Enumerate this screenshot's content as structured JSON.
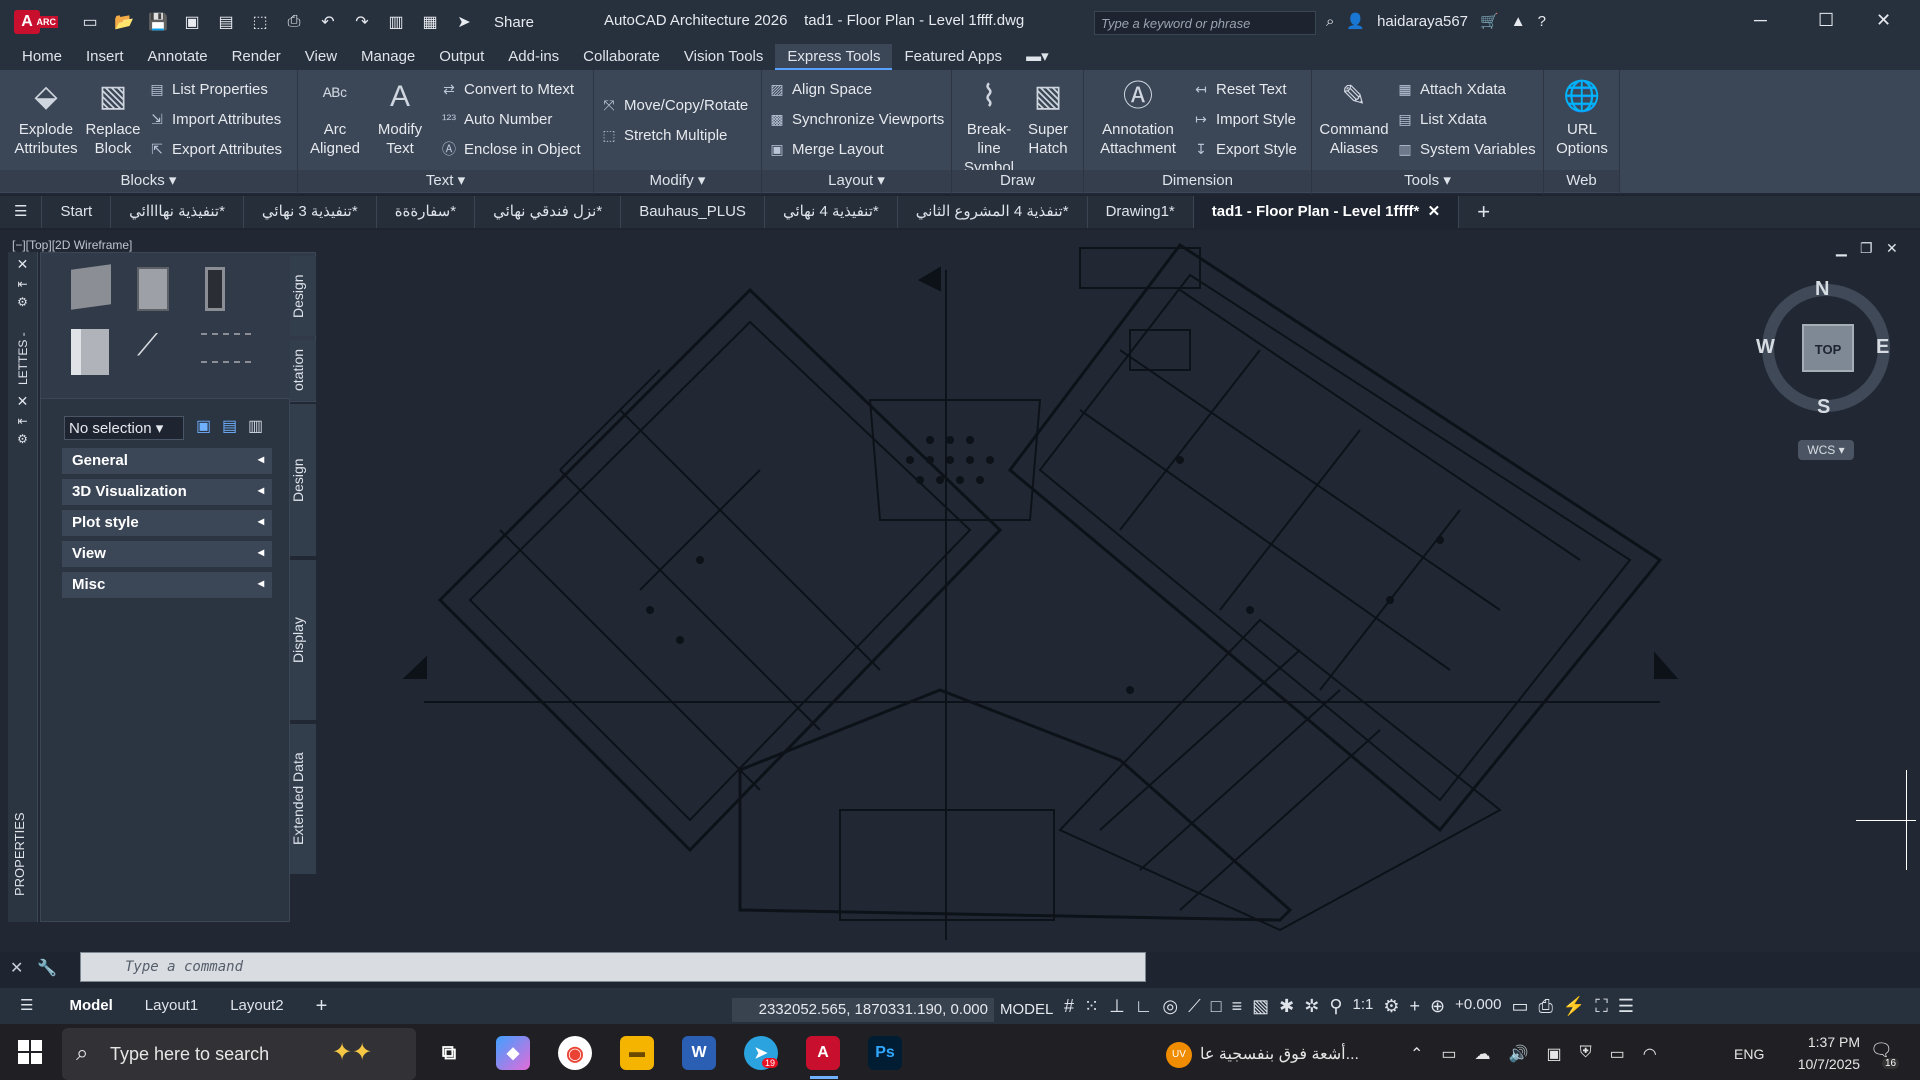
{
  "titlebar": {
    "app_badge": "A",
    "app_badge_sub": "ARC",
    "share_label": "Share",
    "app_name": "AutoCAD Architecture 2026",
    "document": "tad1 - Floor Plan - Level 1ffff.dwg",
    "search_placeholder": "Type a keyword or phrase",
    "username": "haidaraya567"
  },
  "ribbon_tabs": [
    "Home",
    "Insert",
    "Annotate",
    "Render",
    "View",
    "Manage",
    "Output",
    "Add-ins",
    "Collaborate",
    "Vision Tools",
    "Express Tools",
    "Featured Apps"
  ],
  "active_ribbon_tab": "Express Tools",
  "ribbon": {
    "blocks": {
      "label": "Blocks",
      "explode": "Explode Attributes",
      "replace": "Replace Block",
      "list_props": "List Properties",
      "import_attr": "Import Attributes",
      "export_attr": "Export Attributes"
    },
    "text": {
      "label": "Text",
      "arc_aligned": "Arc Aligned",
      "modify_text": "Modify Text",
      "convert_mtext": "Convert to Mtext",
      "auto_number": "Auto Number",
      "enclose": "Enclose in Object"
    },
    "modify": {
      "label": "Modify",
      "move_copy": "Move/Copy/Rotate",
      "stretch": "Stretch Multiple"
    },
    "layout": {
      "label": "Layout",
      "align_space": "Align Space",
      "sync_viewports": "Synchronize Viewports",
      "merge_layout": "Merge Layout"
    },
    "draw": {
      "label": "Draw",
      "breakline": "Break-line Symbol",
      "super_hatch": "Super Hatch"
    },
    "dimension": {
      "label": "Dimension",
      "annotation_attach": "Annotation Attachment",
      "reset_text": "Reset Text",
      "import_style": "Import Style",
      "export_style": "Export Style"
    },
    "tools": {
      "label": "Tools",
      "command_aliases": "Command Aliases",
      "attach_xdata": "Attach Xdata",
      "list_xdata": "List Xdata",
      "system_vars": "System Variables"
    },
    "web": {
      "label": "Web",
      "url_options": "URL Options"
    }
  },
  "file_tabs": [
    "Start",
    "تنفيذية نهاااائي*",
    "تنفيذية 3 نهائي*",
    "سفارةةة*",
    "نزل فندقي نهائي*",
    "Bauhaus_PLUS",
    "تنفيذية 4 نهائي*",
    "تنفذية 4 المشروع الثاني*",
    "Drawing1*",
    "tad1 - Floor Plan - Level 1ffff*"
  ],
  "active_file_tab": "tad1 - Floor Plan - Level 1ffff*",
  "viewport_label": "[−][Top][2D Wireframe]",
  "palette": {
    "side_tabs": [
      "Design",
      "otation",
      "Design",
      "Display",
      "Extended Data"
    ],
    "left_strip_labels": [
      "LETTES -",
      "PROPERTIES"
    ],
    "selection": "No selection",
    "groups": [
      "General",
      "3D Visualization",
      "Plot style",
      "View",
      "Misc"
    ]
  },
  "viewcube": {
    "top": "TOP",
    "n": "N",
    "s": "S",
    "e": "E",
    "w": "W",
    "wcs": "WCS"
  },
  "command": {
    "placeholder": "Type a command"
  },
  "status": {
    "layouts": [
      "Model",
      "Layout1",
      "Layout2"
    ],
    "active_layout": "Model",
    "coords": "2332052.565, 1870331.190, 0.000",
    "model": "MODEL",
    "scale": "1:1",
    "value": "+0.000"
  },
  "taskbar": {
    "search_placeholder": "Type here to search",
    "news_text": "أشعة فوق بنفسجية عا...",
    "news_badge": "UV",
    "lang": "ENG",
    "time": "1:37 PM",
    "date": "10/7/2025",
    "notif_count": "16",
    "telegram_badge": "19"
  },
  "colors": {
    "accent": "#5aa0ff",
    "autocad_red": "#c8102e",
    "canvas": "#212834",
    "ribbon": "#3b4656"
  }
}
